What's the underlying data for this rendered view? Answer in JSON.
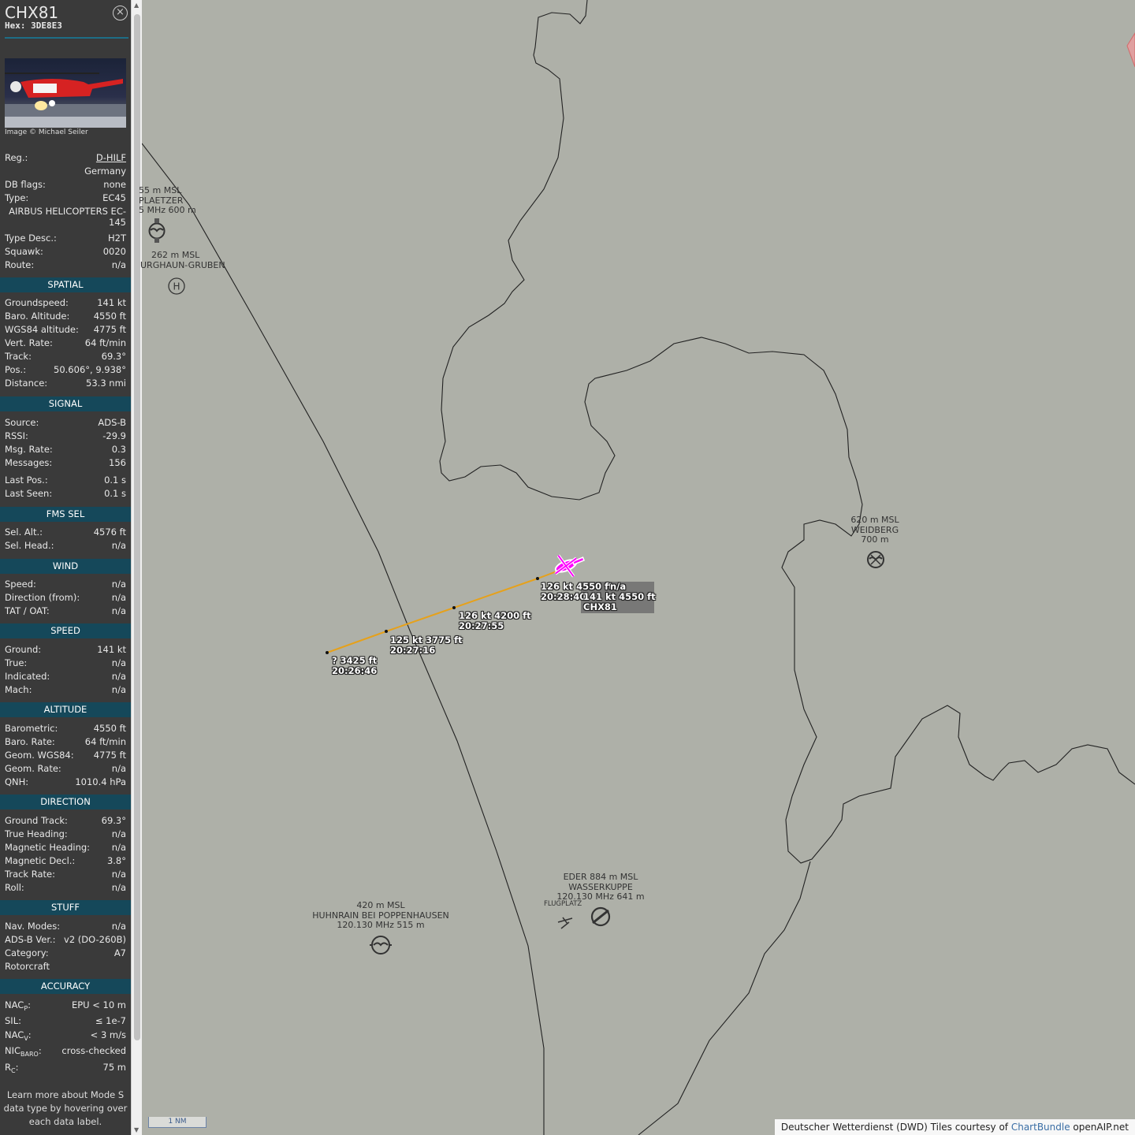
{
  "aircraft": {
    "callsign": "CHX81",
    "hex_label": "Hex: ",
    "hex": "3DE8E3",
    "close_icon": "close-circle-icon",
    "photo_credit": "Image © Michael Seiler"
  },
  "info": {
    "reg_label": "Reg.:",
    "reg": "D-HILF",
    "country": "Germany",
    "dbflags_label": "DB flags:",
    "dbflags": "none",
    "type_label": "Type:",
    "type": "EC45",
    "type_name": "AIRBUS HELICOPTERS EC-145",
    "typedesc_label": "Type Desc.:",
    "typedesc": "H2T",
    "squawk_label": "Squawk:",
    "squawk": "0020",
    "route_label": "Route:",
    "route": "n/a"
  },
  "sections": {
    "spatial": "SPATIAL",
    "signal": "SIGNAL",
    "fms": "FMS SEL",
    "wind": "WIND",
    "speed": "SPEED",
    "altitude": "ALTITUDE",
    "direction": "DIRECTION",
    "stuff": "STUFF",
    "accuracy": "ACCURACY"
  },
  "spatial": [
    {
      "k": "Groundspeed:",
      "v": "141 kt"
    },
    {
      "k": "Baro. Altitude:",
      "v": "4550 ft"
    },
    {
      "k": "WGS84 altitude:",
      "v": "4775 ft"
    },
    {
      "k": "Vert. Rate:",
      "v": "64 ft/min"
    },
    {
      "k": "Track:",
      "v": "69.3°"
    },
    {
      "k": "Pos.:",
      "v": "50.606°, 9.938°"
    },
    {
      "k": "Distance:",
      "v": "53.3 nmi"
    }
  ],
  "signal": [
    {
      "k": "Source:",
      "v": "ADS-B"
    },
    {
      "k": "RSSI:",
      "v": "-29.9"
    },
    {
      "k": "Msg. Rate:",
      "v": "0.3"
    },
    {
      "k": "Messages:",
      "v": "156"
    },
    {
      "k": "Last Pos.:",
      "v": "0.1 s"
    },
    {
      "k": "Last Seen:",
      "v": "0.1 s"
    }
  ],
  "fms": [
    {
      "k": "Sel. Alt.:",
      "v": "4576 ft"
    },
    {
      "k": "Sel. Head.:",
      "v": "n/a"
    }
  ],
  "wind": [
    {
      "k": "Speed:",
      "v": "n/a"
    },
    {
      "k": "Direction (from):",
      "v": "n/a"
    },
    {
      "k": "TAT / OAT:",
      "v": "n/a"
    }
  ],
  "speed": [
    {
      "k": "Ground:",
      "v": "141 kt"
    },
    {
      "k": "True:",
      "v": "n/a"
    },
    {
      "k": "Indicated:",
      "v": "n/a"
    },
    {
      "k": "Mach:",
      "v": "n/a"
    }
  ],
  "altitude": [
    {
      "k": "Barometric:",
      "v": "4550 ft"
    },
    {
      "k": "Baro. Rate:",
      "v": "64 ft/min"
    },
    {
      "k": "Geom. WGS84:",
      "v": "4775 ft"
    },
    {
      "k": "Geom. Rate:",
      "v": "n/a"
    },
    {
      "k": "QNH:",
      "v": "1010.4 hPa"
    }
  ],
  "direction": [
    {
      "k": "Ground Track:",
      "v": "69.3°"
    },
    {
      "k": "True Heading:",
      "v": "n/a"
    },
    {
      "k": "Magnetic Heading:",
      "v": "n/a"
    },
    {
      "k": "Magnetic Decl.:",
      "v": "3.8°"
    },
    {
      "k": "Track Rate:",
      "v": "n/a"
    },
    {
      "k": "Roll:",
      "v": "n/a"
    }
  ],
  "stuff": [
    {
      "k": "Nav. Modes:",
      "v": "n/a"
    },
    {
      "k": "ADS-B Ver.:",
      "v": "v2 (DO-260B)"
    },
    {
      "k": "Category:",
      "v": "A7"
    },
    {
      "k": "Rotorcraft",
      "v": ""
    }
  ],
  "accuracy": {
    "nacp_k": "NAC",
    "nacp_sub": "P",
    "nacp_v": "EPU < 10 m",
    "sil_k": "SIL:",
    "sil_v": "≤ 1e-7",
    "nacv_k": "NAC",
    "nacv_sub": "V",
    "nacv_v": "< 3 m/s",
    "nicbaro_k": "NIC",
    "nicbaro_sub": "BARO",
    "nicbaro_v": "cross-checked",
    "rc_k": "R",
    "rc_sub": "C",
    "rc_v": "75 m"
  },
  "learn_more": "Learn more about Mode S data type by hovering over each data label.",
  "map": {
    "airfields": [
      {
        "l1": "55 m MSL",
        "l2": "PLAETZER",
        "l3": "5 MHz 600 m"
      },
      {
        "l1": "262 m MSL",
        "l2": "URGHAUN-GRUBEN",
        "l3": ""
      },
      {
        "l1": "620 m MSL",
        "l2": "WEIDBERG",
        "l3": "700 m"
      },
      {
        "l1": "420 m MSL",
        "l2": "HUHNRAIN BEI POPPENHAUSEN",
        "l3": "120.130 MHz 515 m"
      },
      {
        "l1": "EDER 884 m MSL",
        "l2": "WASSERKUPPE",
        "l3": "120.130 MHz 641 m"
      }
    ],
    "flugplatz": "FLUGPLATZ",
    "track_labels": [
      {
        "a": "?    3425 ft",
        "b": "20:26:46"
      },
      {
        "a": "125 kt  3775 ft",
        "b": "20:27:16"
      },
      {
        "a": "126 kt  4200 ft",
        "b": "20:27:55"
      },
      {
        "a": "126 kt  4550 ft",
        "b": "20:28:40"
      }
    ],
    "plane_label": {
      "a": "n/a",
      "b": "141 kt  4550 ft",
      "c": "CHX81"
    },
    "track_color": "#e6a11b",
    "plane_color": "#ff00ff",
    "scale": "1 NM",
    "attribution_pre": "Deutscher Wetterdienst (DWD) Tiles courtesy of ",
    "attribution_link": "ChartBundle",
    "attribution_post": " openAIP.net"
  }
}
